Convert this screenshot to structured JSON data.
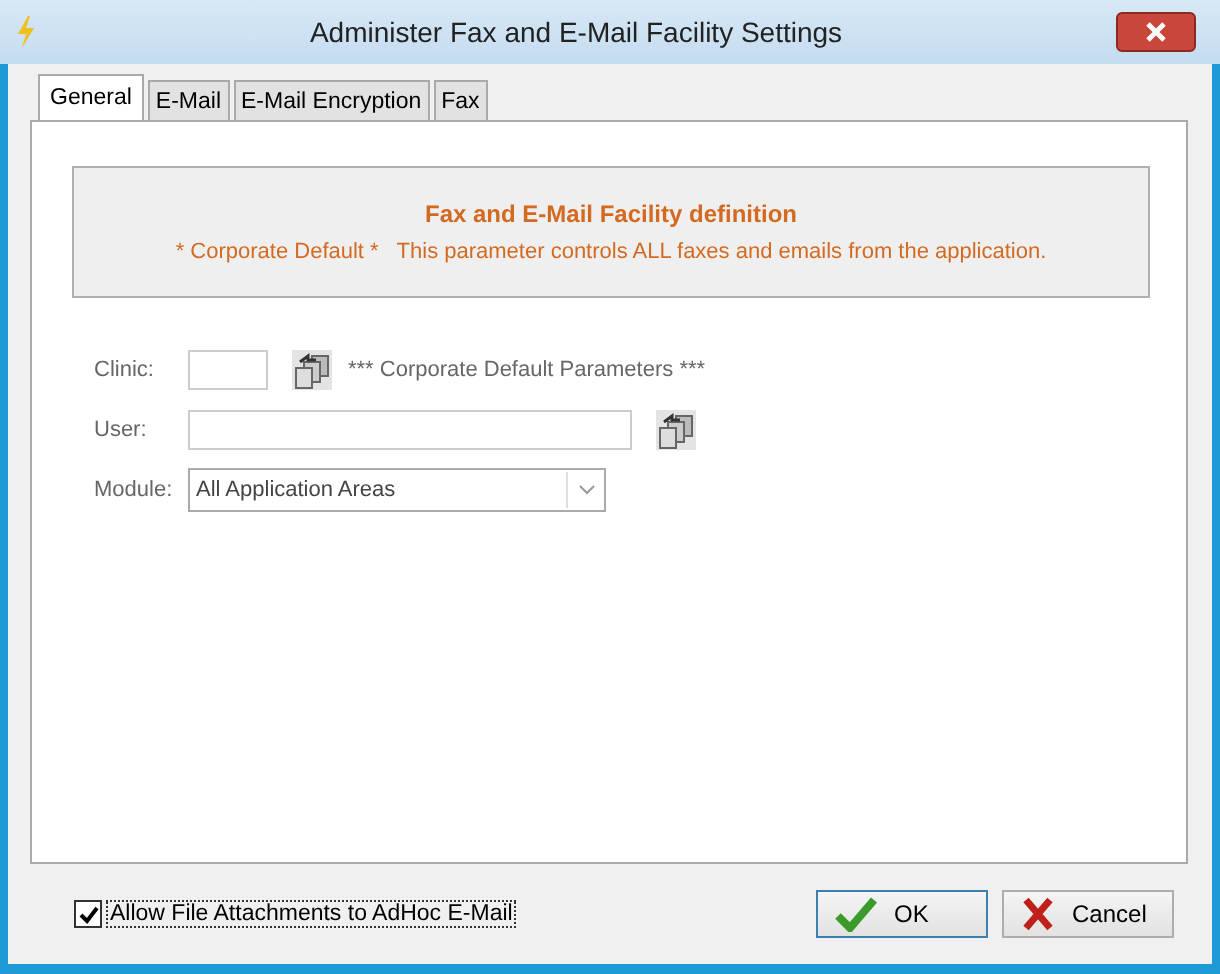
{
  "window": {
    "title": "Administer Fax and E-Mail Facility Settings"
  },
  "tabs": [
    {
      "label": "General",
      "selected": true
    },
    {
      "label": "E-Mail",
      "selected": false
    },
    {
      "label": "E-Mail Encryption",
      "selected": false
    },
    {
      "label": "Fax",
      "selected": false
    }
  ],
  "info": {
    "heading": "Fax and E-Mail Facility definition",
    "text": "* Corporate Default *   This parameter controls ALL faxes and emails from the application."
  },
  "form": {
    "clinic": {
      "label": "Clinic:",
      "note": "*** Corporate Default Parameters ***"
    },
    "user": {
      "label": "User:"
    },
    "module": {
      "label": "Module:",
      "value": "All Application Areas"
    }
  },
  "attachments": {
    "label": "Allow File Attachments to AdHoc E-Mail",
    "checked": true
  },
  "buttons": [
    {
      "kind": "ok",
      "label": "OK"
    },
    {
      "kind": "cancel",
      "label": "Cancel"
    }
  ]
}
